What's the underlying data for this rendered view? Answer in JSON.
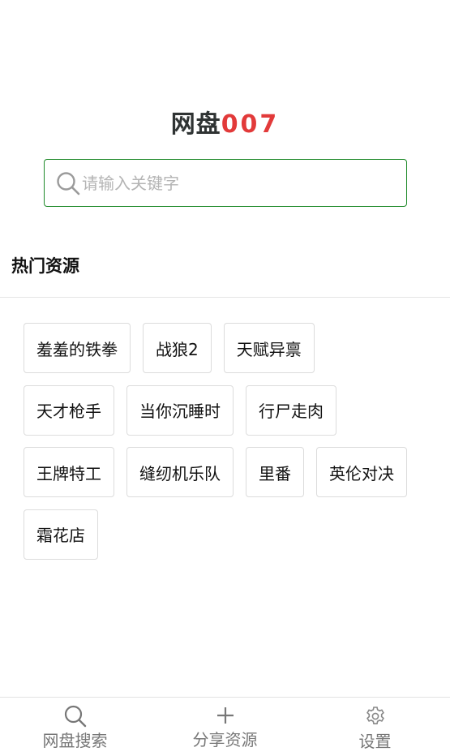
{
  "logo": {
    "text_cn": "网盘",
    "text_num": "007",
    "colors": {
      "cn": "#2f3333",
      "num": "#e23a3a"
    }
  },
  "search": {
    "placeholder": "请输入关键字",
    "value": "",
    "border_color": "#1f8a2a",
    "icon": "search-icon"
  },
  "hot": {
    "title": "热门资源",
    "rows": [
      [
        "羞羞的铁拳",
        "战狼2",
        "天赋异禀"
      ],
      [
        "天才枪手",
        "当你沉睡时",
        "行尸走肉"
      ],
      [
        "王牌特工",
        "缝纫机乐队",
        "里番",
        "英伦对决"
      ],
      [
        "霜花店"
      ]
    ]
  },
  "nav": [
    {
      "label": "网盘搜索",
      "icon": "search-icon"
    },
    {
      "label": "分享资源",
      "icon": "plus-icon"
    },
    {
      "label": "设置",
      "icon": "gear-icon"
    }
  ]
}
